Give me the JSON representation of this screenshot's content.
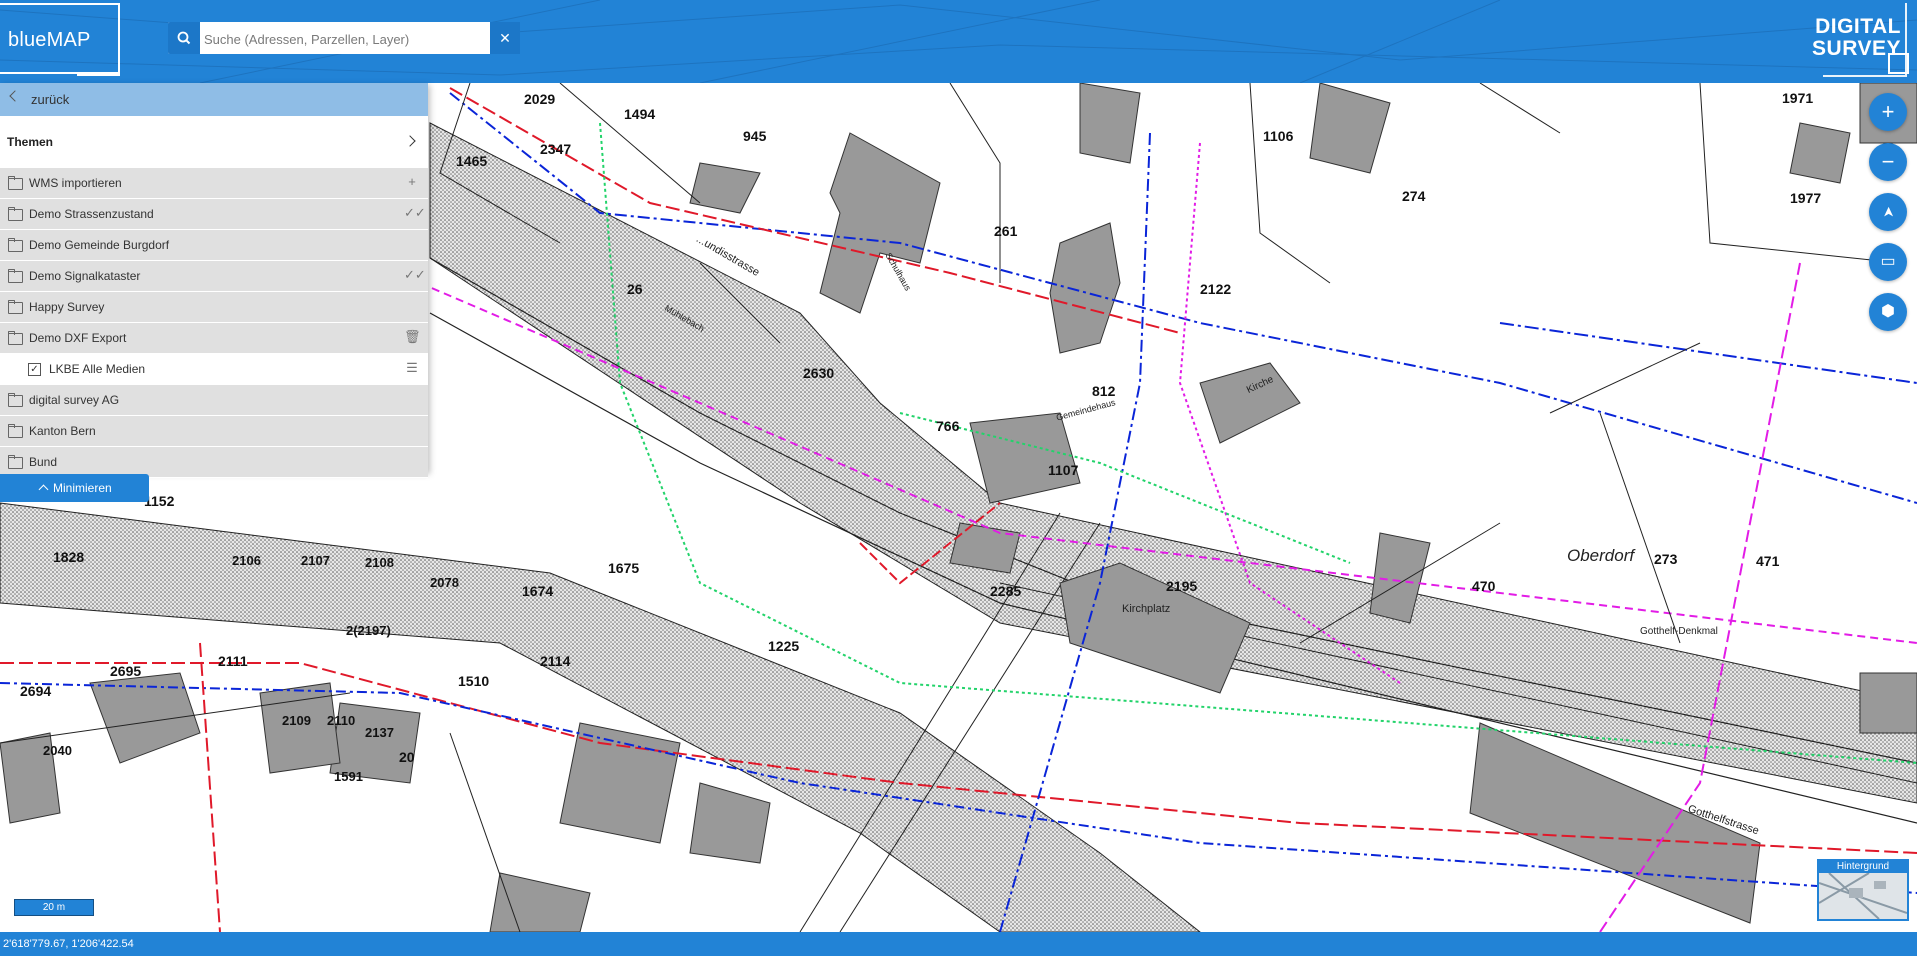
{
  "header": {
    "logo_text": "blueMAP",
    "brand_line1": "DIGITAL",
    "brand_line2": "SURVEY"
  },
  "search": {
    "placeholder": "Suche (Adressen, Parzellen, Layer)",
    "value": "",
    "search_icon": "search-icon",
    "clear_icon": "close-icon",
    "clear_symbol": "✕"
  },
  "panel": {
    "back_label": "zurück",
    "themes_label": "Themen",
    "items": [
      {
        "label": "WMS importieren",
        "action": "+",
        "action_icon": "plus-icon"
      },
      {
        "label": "Demo Strassenzustand",
        "action": "✓✓",
        "action_icon": "double-check-icon"
      },
      {
        "label": "Demo Gemeinde Burgdorf",
        "action": "",
        "action_icon": ""
      },
      {
        "label": "Demo Signalkataster",
        "action": "✓✓",
        "action_icon": "double-check-icon"
      },
      {
        "label": "Happy Survey",
        "action": "",
        "action_icon": ""
      },
      {
        "label": "Demo DXF Export",
        "action": "🗑",
        "action_icon": "trash-icon"
      },
      {
        "label": "LKBE Alle Medien",
        "action": "☰",
        "action_icon": "list-icon",
        "checked": true
      },
      {
        "label": "digital survey AG",
        "action": "",
        "action_icon": ""
      },
      {
        "label": "Kanton Bern",
        "action": "",
        "action_icon": ""
      },
      {
        "label": "Bund",
        "action": "",
        "action_icon": ""
      }
    ],
    "minimize_label": "Minimieren"
  },
  "map_controls": {
    "zoom_in": "+",
    "zoom_out": "−",
    "locate": "➤",
    "screen": "▭",
    "box3d": "⬢",
    "background_label": "Hintergrund"
  },
  "map_labels": {
    "parcels": [
      "2029",
      "1494",
      "945",
      "2347",
      "1465",
      "1106",
      "274",
      "1971",
      "1977",
      "261",
      "26",
      "2122",
      "2630",
      "812",
      "1107",
      "766",
      "1152",
      "1828",
      "2106",
      "2107",
      "2108",
      "2078",
      "1674",
      "1675",
      "2285",
      "2195",
      "2111",
      "2695",
      "2694",
      "2109",
      "2110",
      "2137",
      "2114",
      "1510",
      "1225",
      "470",
      "471",
      "273",
      "20",
      "2(2197)",
      "1591",
      "2040"
    ],
    "places": [
      "Oberdorf",
      "Gotthelfstrasse",
      "Kirchplatz",
      "Gotthelf-Denkmal",
      "Kirche",
      "Gemeindehaus",
      "Schulhaus",
      "Mühlebach",
      "...undisstrasse"
    ]
  },
  "scale_label": "20 m",
  "footer": {
    "coordinates": "2'618'779.67, 1'206'422.54"
  },
  "colors": {
    "brand_blue": "#2283d6",
    "panel_grey": "#e0e0e0",
    "back_row": "#8fbde6"
  }
}
